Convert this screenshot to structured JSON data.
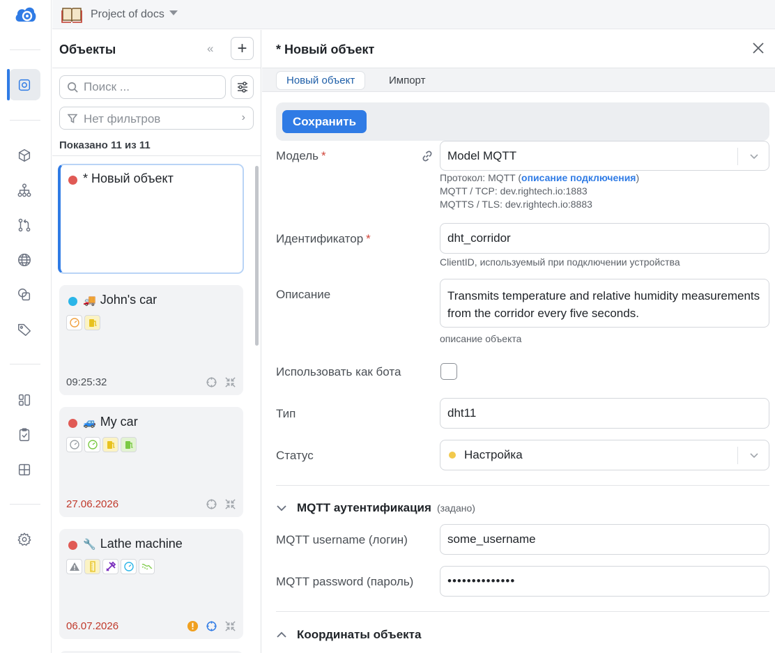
{
  "topbar": {
    "project_name": "Project of docs"
  },
  "list": {
    "title": "Объекты",
    "search_placeholder": "Поиск ...",
    "filter_label": "Нет фильтров",
    "shown_count": "Показано 11 из 11",
    "items": [
      {
        "name": "* Новый объект",
        "status_color": "#e05a55",
        "emoji": "",
        "time": ""
      },
      {
        "name": "John's car",
        "status_color": "#2bb5e8",
        "emoji": "🚚",
        "time": "09:25:32"
      },
      {
        "name": "My car",
        "status_color": "#e05a55",
        "emoji": "🚙",
        "time": "27.06.2026"
      },
      {
        "name": "Lathe machine",
        "status_color": "#e05a55",
        "emoji": "🔧",
        "time": "06.07.2026"
      }
    ]
  },
  "form": {
    "title": "* Новый объект",
    "tabs": [
      {
        "label": "Новый объект"
      },
      {
        "label": "Импорт"
      }
    ],
    "save_label": "Сохранить",
    "model": {
      "label": "Модель",
      "required_mark": "*",
      "value": "Model MQTT",
      "hint_protocol_prefix": "Протокол: MQTT (",
      "hint_link": "описание подключения",
      "hint_protocol_suffix": ")",
      "hint_tcp": "MQTT / TCP: dev.rightech.io:1883",
      "hint_tls": "MQTTS / TLS: dev.rightech.io:8883"
    },
    "identifier": {
      "label": "Идентификатор",
      "required_mark": "*",
      "value": "dht_corridor",
      "hint": "ClientID, используемый при подключении устройства"
    },
    "description": {
      "label": "Описание",
      "value": "Transmits temperature and relative humidity measurements from the corridor every five seconds.",
      "hint": "описание объекта"
    },
    "bot": {
      "label": "Использовать как бота"
    },
    "type": {
      "label": "Тип",
      "value": "dht11"
    },
    "status": {
      "label": "Статус",
      "value": "Настройка",
      "dot_color": "#f2c94c"
    },
    "mqtt_section": {
      "title": "MQTT аутентификация",
      "note": "(задано)"
    },
    "mqtt_username": {
      "label": "MQTT username (логин)",
      "value": "some_username"
    },
    "mqtt_password": {
      "label": "MQTT password (пароль)",
      "value": "••••••••••••••"
    },
    "coords_section": {
      "title": "Координаты объекта"
    }
  },
  "colors": {
    "accent": "#2f7be5",
    "required": "#d0453a"
  }
}
